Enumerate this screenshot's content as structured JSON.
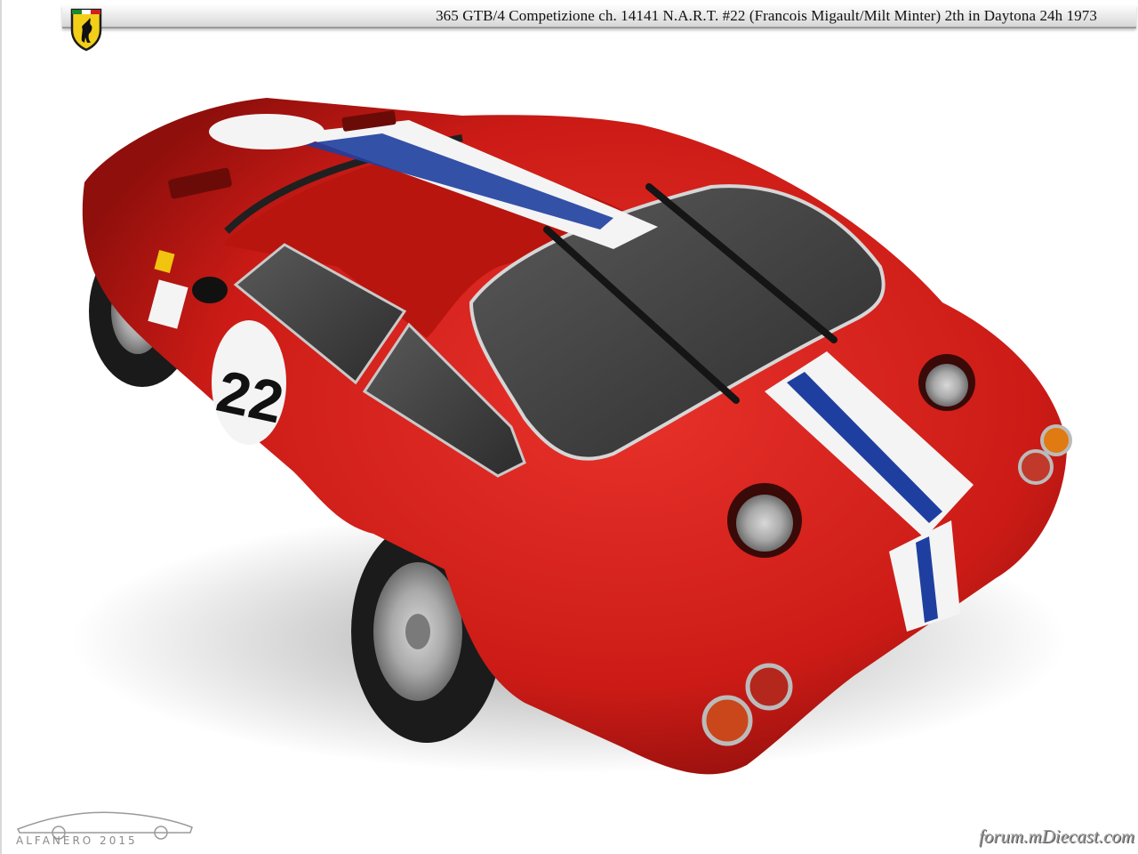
{
  "header": {
    "title": "365 GTB/4 Competizione  ch. 14141  N.A.R.T.  #22 (Francois Migault/Milt Minter)  2th in Daytona 24h 1973",
    "logo_icon": "ferrari-prancing-horse-shield-icon"
  },
  "photo": {
    "car_number": "22",
    "colors": {
      "body": "#d61f1a",
      "stripe_white": "#f4f4f4",
      "stripe_blue": "#1f3fa0",
      "glass": "#3a3a3a"
    }
  },
  "watermarks": {
    "left": "ALFANERO 2015",
    "right": "forum.mDiecast.com"
  }
}
